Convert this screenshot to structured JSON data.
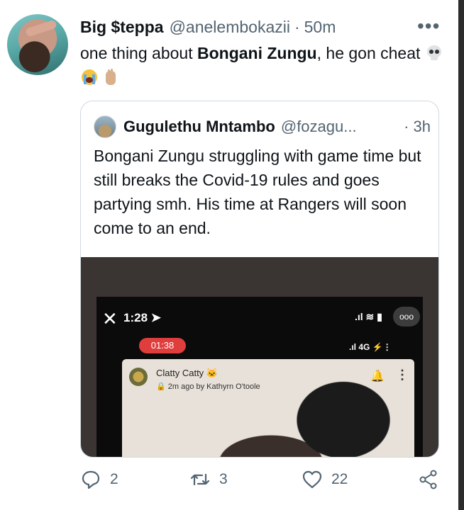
{
  "tweet": {
    "author_name": "Big $teppa",
    "handle": "@anelembokazii",
    "separator": "·",
    "time": "50m",
    "more_icon": "more-horizontal-icon",
    "more_label": "•••",
    "text_before": "one thing about ",
    "text_bold": "Bongani Zungu",
    "text_after": ", he gon cheat",
    "emojis": [
      "skull",
      "loudly-crying-face",
      "raised-hand"
    ]
  },
  "quoted": {
    "author_name": "Gugulethu Mntambo",
    "handle": "@fozagu...",
    "separator": "·",
    "time": "3h",
    "text": "Bongani Zungu struggling with game time but still breaks the Covid-19 rules and goes partying smh. His time at Rangers will soon come to an end.",
    "media": {
      "close_label": "✕",
      "phone_time": "1:28",
      "status_more": "ooo",
      "live_timer": "01:38",
      "network": "4G",
      "card_name": "Clatty Catty",
      "card_sub": "2m ago by Kathyrn O'toole"
    }
  },
  "actions": {
    "reply_count": "2",
    "retweet_count": "3",
    "like_count": "22"
  },
  "colors": {
    "text_primary": "#0f1419",
    "text_secondary": "#536471",
    "border": "#cfd9de",
    "live_red": "#e03d3d"
  }
}
